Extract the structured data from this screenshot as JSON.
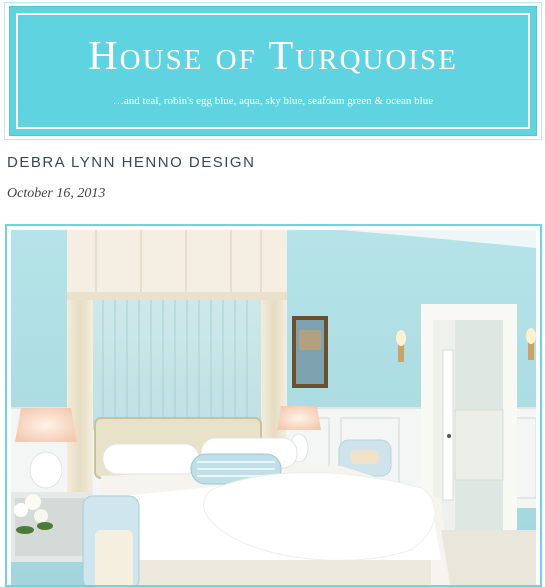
{
  "header": {
    "title": "House of Turquoise",
    "tagline": "…and teal, robin's egg blue, aqua, sky blue, seafoam green & ocean blue"
  },
  "post": {
    "title": "DEBRA LYNN HENNO DESIGN",
    "date": "October 16, 2013"
  },
  "colors": {
    "accent": "#5fd3df",
    "wall": "#a9dde3"
  },
  "photo": {
    "subject": "bedroom-photo"
  }
}
